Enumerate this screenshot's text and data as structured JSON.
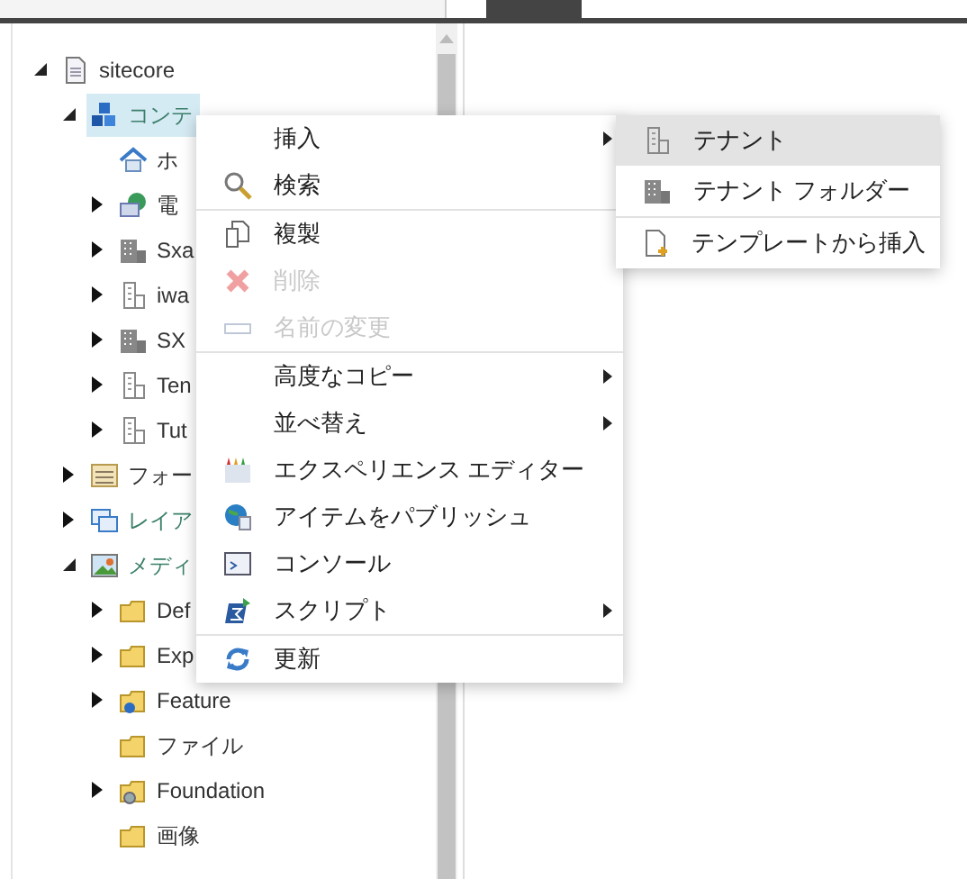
{
  "tree": [
    {
      "label": "sitecore",
      "kind": "page",
      "expanded": true,
      "selected": false,
      "color": "#333333",
      "children": [
        {
          "label": "コンテ",
          "kind": "content",
          "expanded": true,
          "selected": true,
          "color": "#3b7f6a",
          "children": [
            {
              "label": "ホ",
              "kind": "home",
              "selected": false,
              "color": "#333333"
            },
            {
              "label": "電",
              "kind": "mail",
              "expanded": false,
              "selected": false,
              "color": "#333333"
            },
            {
              "label": "Sxa",
              "kind": "building",
              "expanded": false,
              "selected": false,
              "color": "#333333"
            },
            {
              "label": "iwa",
              "kind": "tower",
              "expanded": false,
              "selected": false,
              "color": "#333333"
            },
            {
              "label": "SX",
              "kind": "building",
              "expanded": false,
              "selected": false,
              "color": "#333333"
            },
            {
              "label": "Ten",
              "kind": "tower",
              "expanded": false,
              "selected": false,
              "color": "#333333"
            },
            {
              "label": "Tut",
              "kind": "tower",
              "expanded": false,
              "selected": false,
              "color": "#333333"
            }
          ]
        },
        {
          "label": "フォー",
          "kind": "form",
          "expanded": false,
          "selected": false,
          "color": "#333333"
        },
        {
          "label": "レイア",
          "kind": "layout",
          "expanded": false,
          "selected": false,
          "color": "#3b7f6a"
        },
        {
          "label": "メディ",
          "kind": "media",
          "expanded": true,
          "selected": false,
          "color": "#3b7f6a",
          "children": [
            {
              "label": "Def",
              "kind": "folder",
              "expanded": false,
              "selected": false,
              "color": "#333333"
            },
            {
              "label": "Exp",
              "kind": "folder",
              "expanded": false,
              "selected": false,
              "color": "#333333"
            },
            {
              "label": "Feature",
              "kind": "folder-blue",
              "expanded": false,
              "selected": false,
              "color": "#333333"
            },
            {
              "label": "ファイル",
              "kind": "folder",
              "selected": false,
              "color": "#333333"
            },
            {
              "label": "Foundation",
              "kind": "folder-gear",
              "expanded": false,
              "selected": false,
              "color": "#333333"
            },
            {
              "label": "画像",
              "kind": "folder",
              "selected": false,
              "color": "#333333"
            }
          ]
        }
      ]
    }
  ],
  "context_menu": [
    {
      "label": "挿入",
      "kind": "none",
      "submenu": true,
      "disabled": false
    },
    {
      "label": "検索",
      "kind": "search",
      "submenu": false,
      "disabled": false,
      "divider_after": true
    },
    {
      "label": "複製",
      "kind": "copy",
      "submenu": false,
      "disabled": false
    },
    {
      "label": "削除",
      "kind": "delete",
      "submenu": false,
      "disabled": true
    },
    {
      "label": "名前の変更",
      "kind": "rename",
      "submenu": false,
      "disabled": true,
      "divider_after": true
    },
    {
      "label": "高度なコピー",
      "kind": "none",
      "submenu": true,
      "disabled": false
    },
    {
      "label": "並べ替え",
      "kind": "none",
      "submenu": true,
      "disabled": false
    },
    {
      "label": "エクスペリエンス エディター",
      "kind": "crayons",
      "submenu": false,
      "disabled": false
    },
    {
      "label": "アイテムをパブリッシュ",
      "kind": "globe",
      "submenu": false,
      "disabled": false
    },
    {
      "label": "コンソール",
      "kind": "console",
      "submenu": false,
      "disabled": false
    },
    {
      "label": "スクリプト",
      "kind": "script",
      "submenu": true,
      "disabled": false,
      "divider_after": true
    },
    {
      "label": "更新",
      "kind": "refresh",
      "submenu": false,
      "disabled": false
    }
  ],
  "submenu": [
    {
      "label": "テナント",
      "kind": "tower",
      "selected": true
    },
    {
      "label": "テナント フォルダー",
      "kind": "building",
      "selected": false,
      "divider_after": true
    },
    {
      "label": "テンプレートから挿入",
      "kind": "template",
      "selected": false
    }
  ]
}
